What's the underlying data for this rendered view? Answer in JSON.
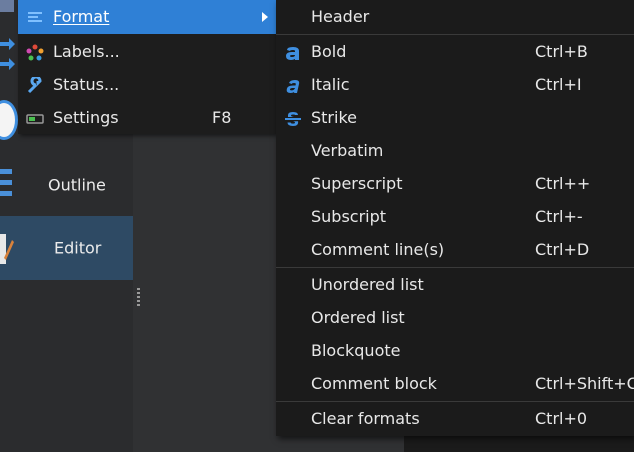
{
  "sidebar": {
    "items": [
      {
        "label": "Outline",
        "icon": "outline-icon"
      },
      {
        "label": "Editor",
        "icon": "editor-icon"
      }
    ]
  },
  "menu": {
    "items": [
      {
        "label": "Format",
        "icon": "format-icon",
        "shortcut": ""
      },
      {
        "label": "Labels...",
        "icon": "labels-icon",
        "shortcut": ""
      },
      {
        "label": "Status...",
        "icon": "wrench-icon",
        "shortcut": ""
      },
      {
        "label": "Settings",
        "icon": "settings-icon",
        "shortcut": "F8"
      }
    ]
  },
  "format_menu": {
    "items": [
      {
        "label": "Header",
        "shortcut": ""
      },
      {
        "label": "Bold",
        "shortcut": "Ctrl+B",
        "icon": "bold-icon"
      },
      {
        "label": "Italic",
        "shortcut": "Ctrl+I",
        "icon": "italic-icon"
      },
      {
        "label": "Strike",
        "shortcut": "",
        "icon": "strike-icon"
      },
      {
        "label": "Verbatim",
        "shortcut": ""
      },
      {
        "label": "Superscript",
        "shortcut": "Ctrl++"
      },
      {
        "label": "Subscript",
        "shortcut": "Ctrl+-"
      },
      {
        "label": "Comment line(s)",
        "shortcut": "Ctrl+D"
      },
      {
        "label": "Unordered list",
        "shortcut": ""
      },
      {
        "label": "Ordered list",
        "shortcut": ""
      },
      {
        "label": "Blockquote",
        "shortcut": ""
      },
      {
        "label": "Comment block",
        "shortcut": "Ctrl+Shift+C"
      },
      {
        "label": "Clear formats",
        "shortcut": "Ctrl+0"
      }
    ]
  },
  "colors": {
    "highlight": "#2f80d6",
    "menu_bg": "#1b1b1b",
    "icon_blue": "#3f8fe0",
    "sidebar_selected": "#2e4a64"
  }
}
